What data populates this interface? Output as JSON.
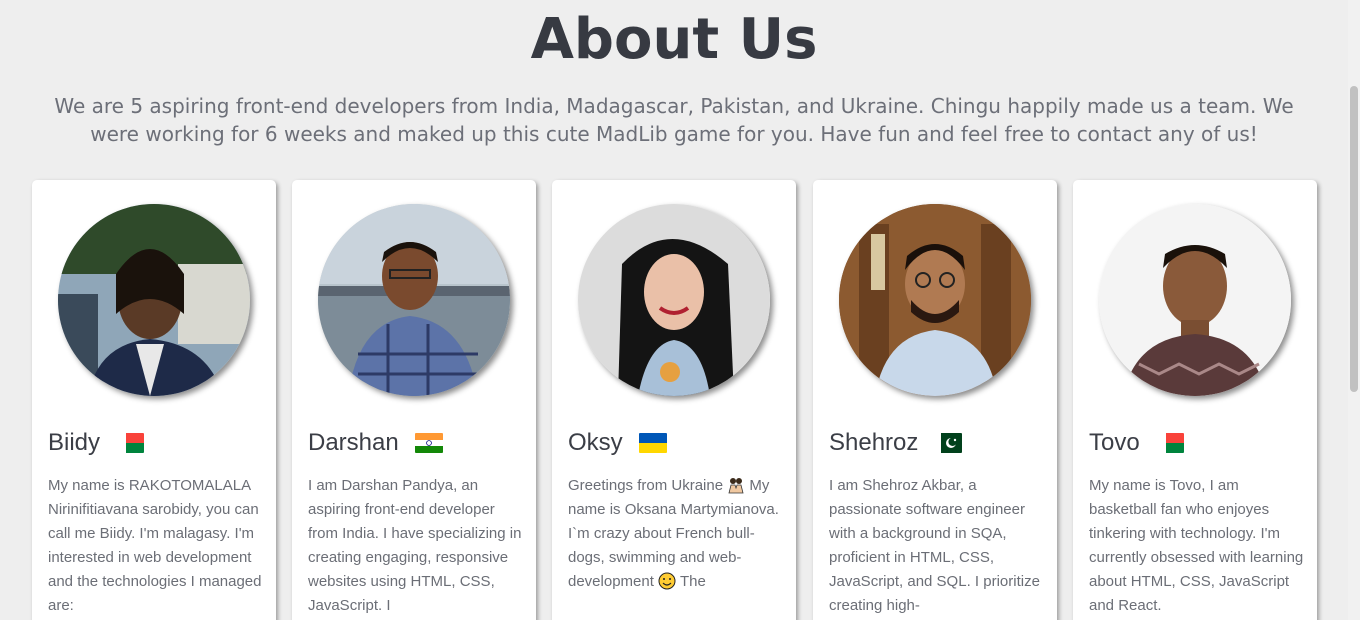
{
  "header": {
    "title": "About Us",
    "subtitle": "We are 5 aspiring front-end developers from India, Madagascar, Pakistan, and Ukraine. Chingu happily made us a team. We were working for 6 weeks and maked up this cute MadLib game for you. Have fun and feel free to contact any of us!"
  },
  "team": [
    {
      "name": "Biidy",
      "flag": "madagascar-flag",
      "bio": "My name is RAKOTOMALALA Nirinifitiavana sarobidy, you can call me Biidy. I'm malagasy. I'm interested in web development and the technologies I managed are:"
    },
    {
      "name": "Darshan",
      "flag": "india-flag",
      "bio": "I am Darshan Pandya, an aspiring front-end developer from India. I have specializing in creating engaging, responsive websites using HTML, CSS, JavaScript. I"
    },
    {
      "name": "Oksy",
      "flag": "ukraine-flag",
      "bio_a": "Greetings from Ukraine",
      "bio_b": "My name is Oksana Martymianova. I`m crazy about French bull-dogs, swimming and web-development",
      "bio_c": "The"
    },
    {
      "name": "Shehroz",
      "flag": "pakistan-flag",
      "bio": "I am Shehroz Akbar, a passionate software engineer with a background in SQA, proficient in HTML, CSS, JavaScript, and SQL. I prioritize creating high-"
    },
    {
      "name": "Tovo",
      "flag": "madagascar-flag",
      "bio": "My name is Tovo, I am basketball fan who enjoyes tinkering with technology. I'm currently obsessed with learning about HTML, CSS, JavaScript and React."
    }
  ],
  "colors": {
    "background": "#eeeeee",
    "title": "#373a42",
    "text": "#6b6e76",
    "card": "#ffffff"
  }
}
